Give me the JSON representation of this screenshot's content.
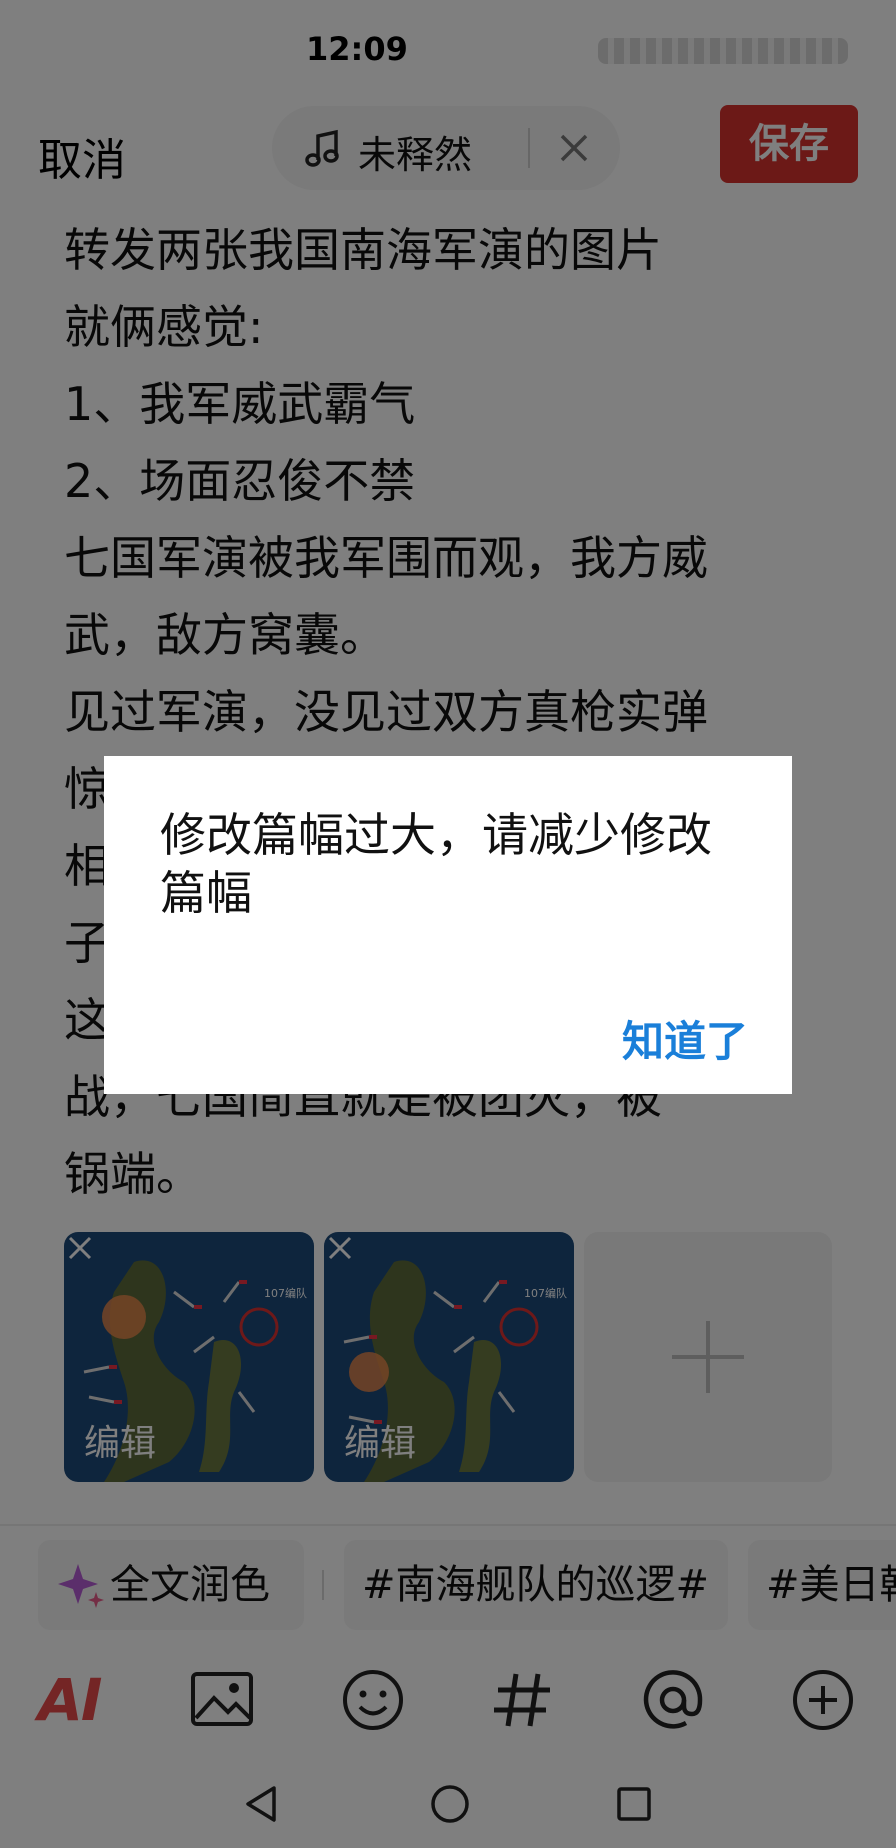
{
  "status": {
    "time": "12:09"
  },
  "header": {
    "cancel_label": "取消",
    "music_name": "未释然",
    "save_label": "保存"
  },
  "content": {
    "lines": [
      "转发两张我国南海军演的图片",
      "就俩感觉:",
      "1、我军威武霸气",
      "2、场面忍俊不禁",
      "七国军演被我军围而观，我方威",
      "武，敌方窝囊。",
      "见过军演，没见过双方真枪实弹",
      "惊",
      "相",
      "子",
      "这",
      "战，七国简直就是被团灭，被",
      "锅端。"
    ]
  },
  "images": {
    "edit_label": "编辑",
    "items": [
      {
        "caption": "107编队"
      },
      {
        "caption": "107编队"
      }
    ]
  },
  "chips": {
    "polish_label": "全文润色",
    "topic_1": "#南海舰队的巡逻#",
    "topic_2": "#美日韩"
  },
  "toolbar": {
    "ai_label": "AI"
  },
  "dialog": {
    "message": "修改篇幅过大，请减少修改篇幅",
    "confirm_label": "知道了"
  },
  "colors": {
    "save_button": "#d9322f",
    "dialog_button": "#1a7fd9",
    "ai_icon": "#e84b4b"
  }
}
